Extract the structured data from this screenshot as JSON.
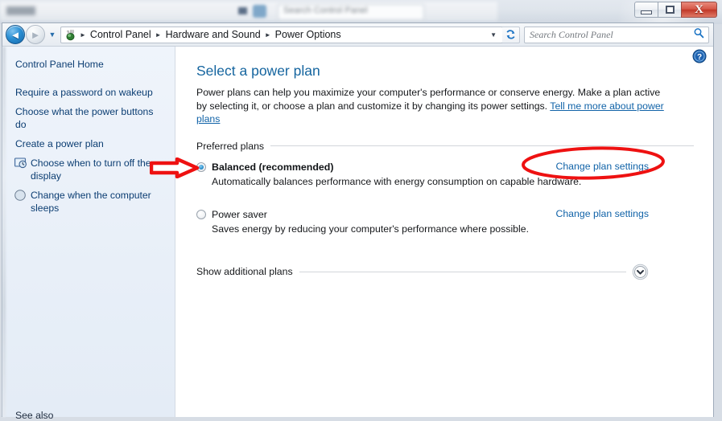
{
  "window": {
    "controls": {
      "minimize_label": "Minimize",
      "maximize_label": "Maximize",
      "close_label": "X"
    }
  },
  "background_window": {
    "search_placeholder": "Search Control Panel"
  },
  "addressbar": {
    "back_label": "◄",
    "forward_label": "►",
    "recent_dropdown_label": "▼",
    "breadcrumb": [
      {
        "label": "Control Panel"
      },
      {
        "label": "Hardware and Sound"
      },
      {
        "label": "Power Options"
      }
    ],
    "separator": "►",
    "crumb_dropdown": "▼",
    "refresh_label": "↻",
    "search_placeholder": "Search Control Panel"
  },
  "sidebar": {
    "items": [
      {
        "label": "Control Panel Home",
        "icon": ""
      },
      {
        "label": "Require a password on wakeup",
        "icon": ""
      },
      {
        "label": "Choose what the power buttons do",
        "icon": ""
      },
      {
        "label": "Create a power plan",
        "icon": ""
      },
      {
        "label": "Choose when to turn off the display",
        "icon": "display-clock-icon"
      },
      {
        "label": "Change when the computer sleeps",
        "icon": "moon-sleep-icon"
      }
    ],
    "see_also_label": "See also"
  },
  "content": {
    "help_label": "?",
    "title": "Select a power plan",
    "description_part1": "Power plans can help you maximize your computer's performance or conserve energy. Make a plan active by selecting it, or choose a plan and customize it by changing its power settings. ",
    "description_link": "Tell me more about power plans",
    "preferred_plans_label": "Preferred plans",
    "plans": [
      {
        "name": "Balanced (recommended)",
        "description": "Automatically balances performance with energy consumption on capable hardware.",
        "selected": true,
        "change_link": "Change plan settings"
      },
      {
        "name": "Power saver",
        "description": "Saves energy by reducing your computer's performance where possible.",
        "selected": false,
        "change_link": "Change plan settings"
      }
    ],
    "show_additional_label": "Show additional plans",
    "expand_label": "⌄"
  },
  "annotations": {
    "arrow_color": "#ee1111",
    "ellipse_color": "#ee1111",
    "arrow_target": "balanced-radio",
    "ellipse_target": "balanced-change-plan-settings-link"
  }
}
